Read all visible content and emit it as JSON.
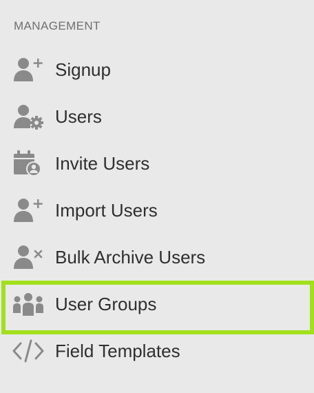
{
  "sidebar": {
    "section_title": "MANAGEMENT",
    "highlight_color": "#a2e01e",
    "icon_color": "#8a8a8a",
    "items": [
      {
        "label": "Signup",
        "icon": "user-plus-icon"
      },
      {
        "label": "Users",
        "icon": "user-gear-icon"
      },
      {
        "label": "Invite Users",
        "icon": "calendar-user-icon"
      },
      {
        "label": "Import Users",
        "icon": "user-plus-icon"
      },
      {
        "label": "Bulk Archive Users",
        "icon": "user-times-icon"
      },
      {
        "label": "User Groups",
        "icon": "users-group-icon",
        "highlighted": true
      },
      {
        "label": "Field Templates",
        "icon": "code-icon"
      }
    ]
  }
}
